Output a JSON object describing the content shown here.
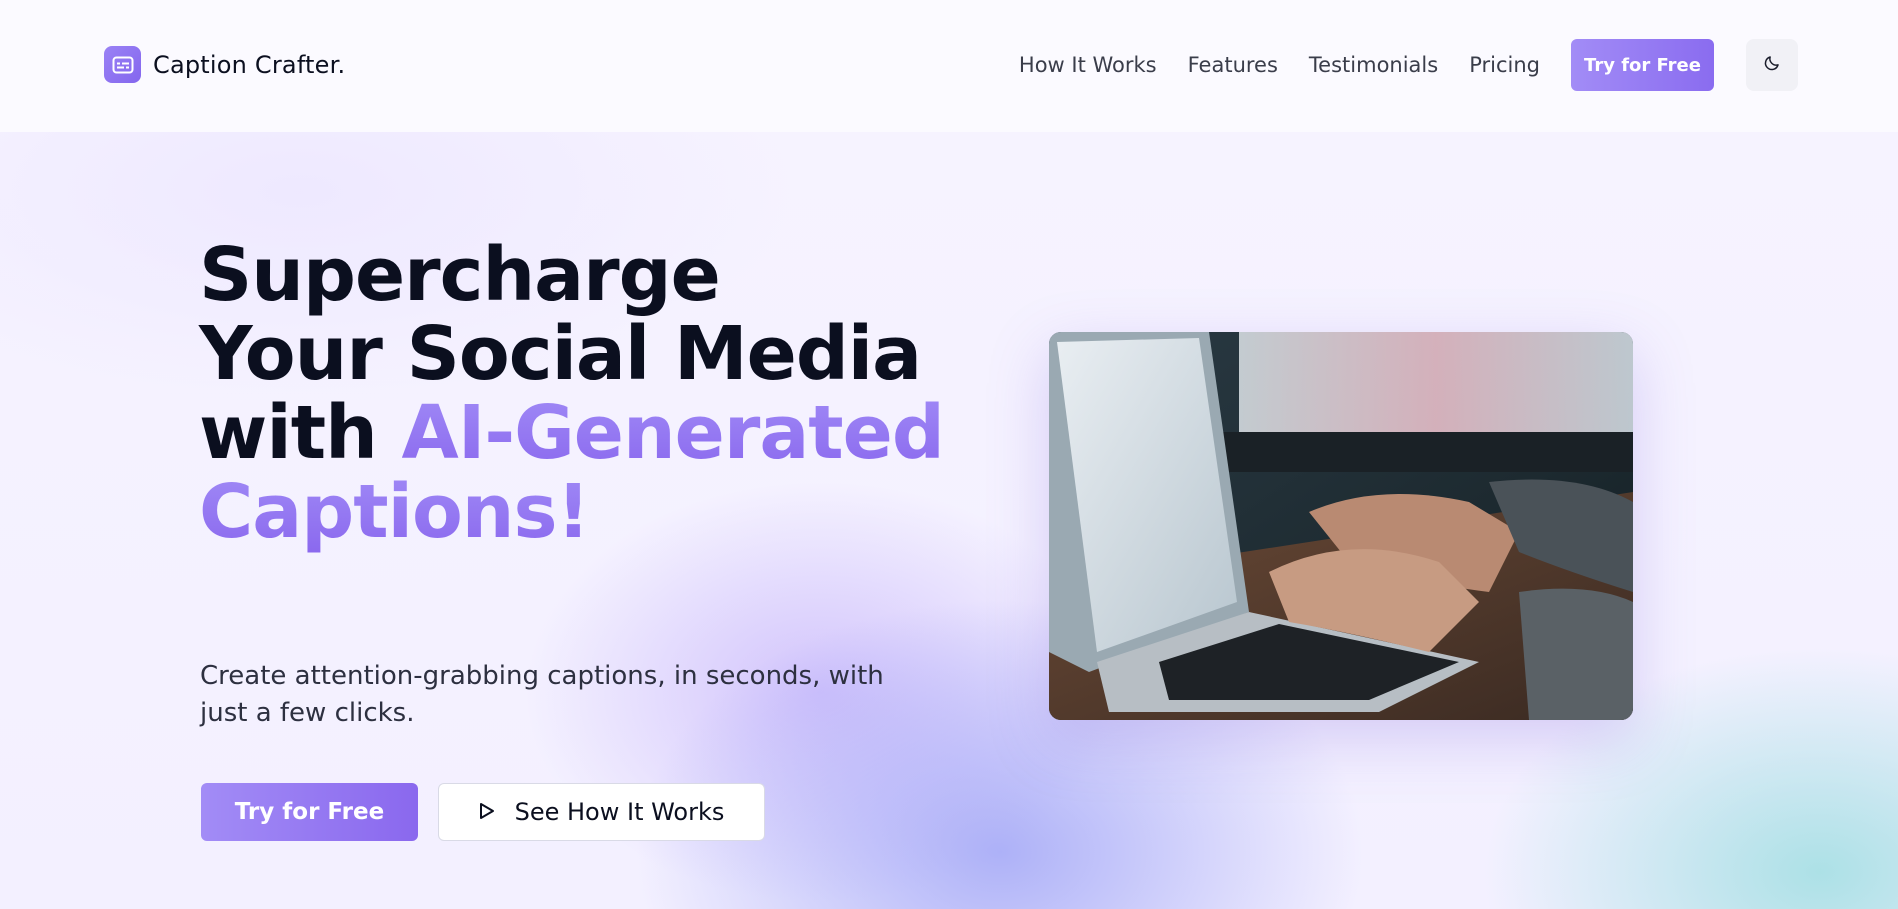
{
  "brand": {
    "name": "Caption Crafter."
  },
  "nav": {
    "links": [
      "How It Works",
      "Features",
      "Testimonials",
      "Pricing"
    ],
    "cta": "Try for Free",
    "theme_toggle_icon": "moon-icon"
  },
  "hero": {
    "title_line1": "Supercharge",
    "title_line2": "Your Social Media",
    "title_line3_plain": "with ",
    "title_accent": "AI-Generated Captions!",
    "subtitle": "Create attention-grabbing captions, in seconds, with just a few clicks.",
    "primary_cta": "Try for Free",
    "secondary_cta": "See How It Works",
    "secondary_cta_icon": "play-icon",
    "image_icon": "laptop-typing-photo"
  },
  "colors": {
    "accent": "#8a6cf0",
    "accent_light": "#a28cf6",
    "text": "#0b0f1f"
  }
}
